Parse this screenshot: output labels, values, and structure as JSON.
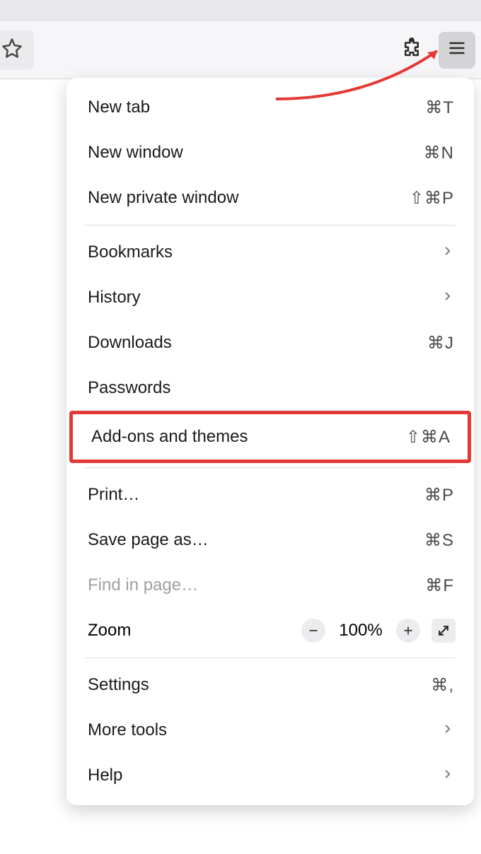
{
  "toolbar": {
    "star_icon": "star",
    "extensions_icon": "puzzle",
    "hamburger_icon": "menu"
  },
  "menu": {
    "section1": [
      {
        "label": "New tab",
        "shortcut": "⌘T"
      },
      {
        "label": "New window",
        "shortcut": "⌘N"
      },
      {
        "label": "New private window",
        "shortcut": "⇧⌘P"
      }
    ],
    "section2": [
      {
        "label": "Bookmarks",
        "chevron": true
      },
      {
        "label": "History",
        "chevron": true
      },
      {
        "label": "Downloads",
        "shortcut": "⌘J"
      },
      {
        "label": "Passwords"
      }
    ],
    "highlighted": {
      "label": "Add-ons and themes",
      "shortcut": "⇧⌘A"
    },
    "section3": [
      {
        "label": "Print…",
        "shortcut": "⌘P"
      },
      {
        "label": "Save page as…",
        "shortcut": "⌘S"
      },
      {
        "label": "Find in page…",
        "shortcut": "⌘F",
        "disabled": true
      }
    ],
    "zoom": {
      "label": "Zoom",
      "value": "100%"
    },
    "section4": [
      {
        "label": "Settings",
        "shortcut": "⌘,"
      },
      {
        "label": "More tools",
        "chevron": true
      },
      {
        "label": "Help",
        "chevron": true
      }
    ]
  }
}
